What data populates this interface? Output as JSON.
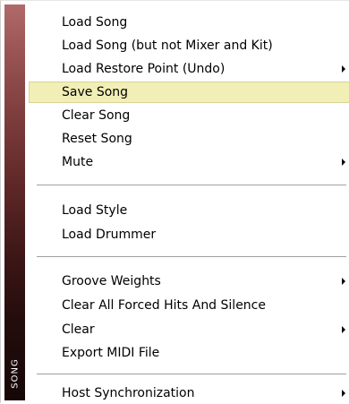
{
  "sidebar": {
    "label": "SONG"
  },
  "items": [
    {
      "label": "Load Song"
    },
    {
      "label": "Load Song (but not Mixer and Kit)"
    },
    {
      "label": "Load Restore Point (Undo)"
    },
    {
      "label": "Save Song"
    },
    {
      "label": "Clear Song"
    },
    {
      "label": "Reset Song"
    },
    {
      "label": "Mute"
    },
    {
      "label": "Load Style"
    },
    {
      "label": "Load Drummer"
    },
    {
      "label": "Groove Weights"
    },
    {
      "label": "Clear All Forced Hits And Silence"
    },
    {
      "label": "Clear"
    },
    {
      "label": "Export MIDI File"
    },
    {
      "label": "Host Synchronization"
    }
  ],
  "selected_item": "Save Song",
  "submenu_items": [
    "Load Restore Point (Undo)",
    "Mute",
    "Groove Weights",
    "Clear",
    "Host Synchronization"
  ],
  "colors": {
    "highlight": "#f1eeb6",
    "sidebar_top": "#b06a6a",
    "sidebar_bottom": "#160707"
  }
}
